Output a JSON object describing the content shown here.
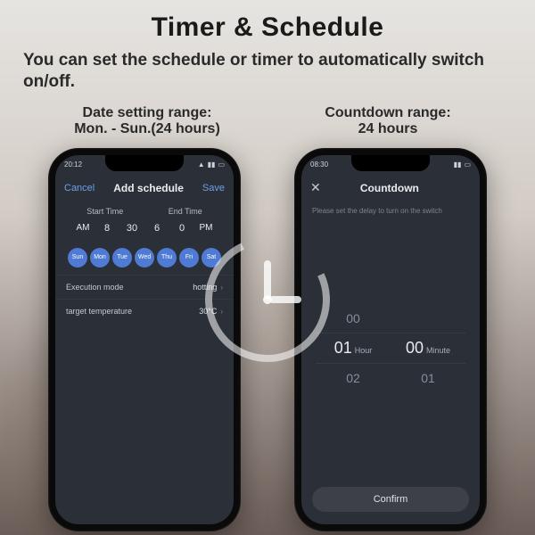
{
  "page": {
    "title": "Timer & Schedule",
    "subtitle": "You can set the schedule or timer to automatically switch on/off."
  },
  "captions": {
    "left_line1": "Date setting range:",
    "left_line2": "Mon. - Sun.(24 hours)",
    "right_line1": "Countdown range:",
    "right_line2": "24 hours"
  },
  "phone_left": {
    "status_time": "20:12",
    "topbar": {
      "cancel": "Cancel",
      "title": "Add schedule",
      "save": "Save"
    },
    "labels": {
      "start": "Start Time",
      "end": "End Time"
    },
    "picker": {
      "am": "AM",
      "h1": "8",
      "m1": "30",
      "h2": "6",
      "m2": "0",
      "pm": "PM"
    },
    "days": [
      "Sun",
      "Mon",
      "Tue",
      "Wed",
      "Thu",
      "Fri",
      "Sat"
    ],
    "rows": {
      "exec_label": "Execution mode",
      "exec_value": "hotting",
      "temp_label": "target temperature",
      "temp_value": "30°C"
    }
  },
  "phone_right": {
    "status_time": "08:30",
    "topbar": {
      "title": "Countdown"
    },
    "hint": "Please set the delay to turn on the switch",
    "picker": {
      "above_h": "00",
      "h": "01",
      "h_unit": "Hour",
      "m": "00",
      "m_unit": "Minute",
      "below_h": "02",
      "below_m": "01"
    },
    "confirm": "Confirm"
  }
}
